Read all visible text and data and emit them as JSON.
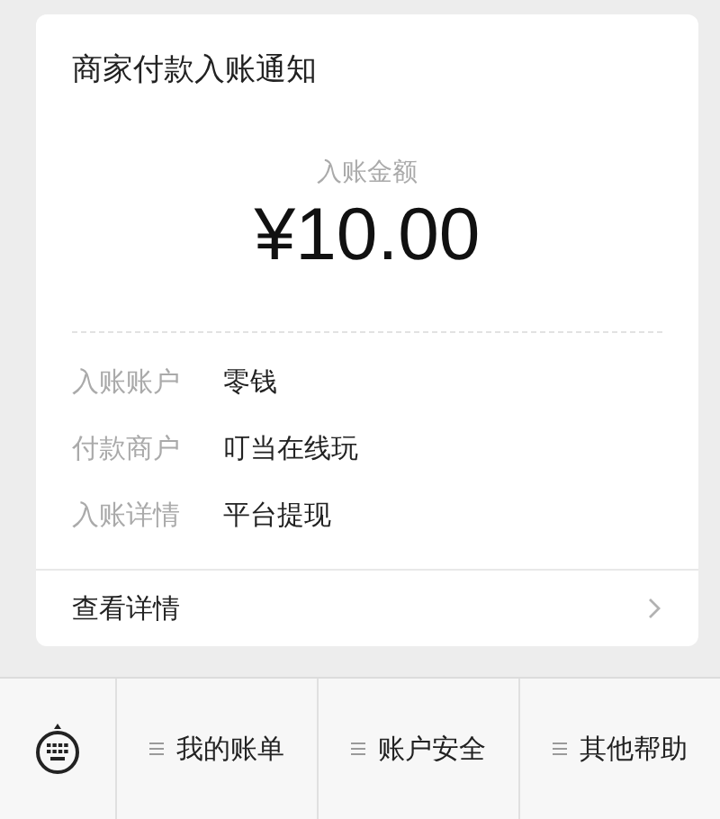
{
  "card": {
    "title": "商家付款入账通知",
    "amount_label": "入账金额",
    "amount": "¥10.00",
    "details": [
      {
        "label": "入账账户",
        "value": "零钱"
      },
      {
        "label": "付款商户",
        "value": "叮当在线玩"
      },
      {
        "label": "入账详情",
        "value": "平台提现"
      }
    ],
    "link": "查看详情"
  },
  "menu_bar": {
    "items": [
      {
        "label": "我的账单"
      },
      {
        "label": "账户安全"
      },
      {
        "label": "其他帮助"
      }
    ]
  }
}
